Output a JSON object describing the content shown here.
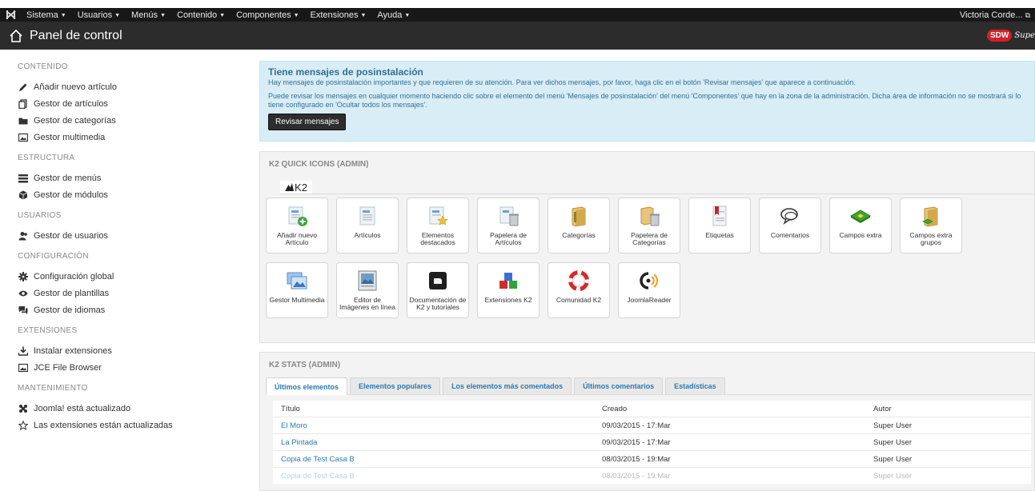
{
  "menubar": {
    "items": [
      "Sistema",
      "Usuarios",
      "Menús",
      "Contenido",
      "Componentes",
      "Extensiones",
      "Ayuda"
    ],
    "user": "Victoria Corde..."
  },
  "title": "Panel de control",
  "brand": {
    "badge": "SDW",
    "text": "Super Tise"
  },
  "sidebar": {
    "sections": [
      {
        "title": "CONTENIDO",
        "items": [
          "Añadir nuevo artículo",
          "Gestor de artículos",
          "Gestor de categorías",
          "Gestor multimedia"
        ]
      },
      {
        "title": "ESTRUCTURA",
        "items": [
          "Gestor de menús",
          "Gestor de módulos"
        ]
      },
      {
        "title": "USUARIOS",
        "items": [
          "Gestor de usuarios"
        ]
      },
      {
        "title": "CONFIGURACIÓN",
        "items": [
          "Configuración global",
          "Gestor de plantillas",
          "Gestor de idiomas"
        ]
      },
      {
        "title": "EXTENSIONES",
        "items": [
          "Instalar extensiones",
          "JCE File Browser"
        ]
      },
      {
        "title": "MANTENIMIENTO",
        "items": [
          "Joomla! está actualizado",
          "Las extensiones están actualizadas"
        ]
      }
    ]
  },
  "alert": {
    "heading": "Tiene mensajes de posinstalación",
    "p1": "Hay mensajes de posinstalación importantes y que requieren de su atención. Para ver dichos mensajes, por favor, haga clic en el botón 'Revisar mensajes' que aparece a continuación.",
    "p2": "Puede revisar los mensajes en cualquier momento haciendo clic sobre el elemento del menú 'Mensajes de posinstalación' del menú 'Componentes' que hay en la zona de la administración. Dicha área de información no se mostrará si lo tiene configurado en 'Ocultar todos los mensajes'.",
    "button": "Revisar mensajes"
  },
  "quickicons": {
    "title": "K2 QUICK ICONS (ADMIN)",
    "logo": "K2",
    "items": [
      {
        "label": "Añadir nuevo Artículo",
        "icon": "add-item-icon"
      },
      {
        "label": "Artículos",
        "icon": "items-icon"
      },
      {
        "label": "Elementos destacados",
        "icon": "featured-items-icon"
      },
      {
        "label": "Papelera de Artículos",
        "icon": "items-trash-icon"
      },
      {
        "label": "Categorías",
        "icon": "categories-icon"
      },
      {
        "label": "Papelera de Categorías",
        "icon": "categories-trash-icon"
      },
      {
        "label": "Etiquetas",
        "icon": "tags-icon"
      },
      {
        "label": "Comentarios",
        "icon": "comments-icon"
      },
      {
        "label": "Campos extra",
        "icon": "extra-fields-icon"
      },
      {
        "label": "Campos extra grupos",
        "icon": "extra-field-groups-icon"
      },
      {
        "label": "Gestor Multimedia",
        "icon": "media-manager-icon"
      },
      {
        "label": "Editor de Imágenes en línea",
        "icon": "image-editor-icon"
      },
      {
        "label": "Documentación de K2 y tutoriales",
        "icon": "documentation-icon"
      },
      {
        "label": "Extensiones K2",
        "icon": "extensions-icon"
      },
      {
        "label": "Comunidad K2",
        "icon": "community-icon"
      },
      {
        "label": "JoomlaReader",
        "icon": "joomlareader-icon"
      }
    ]
  },
  "stats": {
    "title": "K2 STATS (ADMIN)",
    "tabs": [
      "Últimos elementos",
      "Elementos populares",
      "Los elementos más comentados",
      "Últimos comentarios",
      "Estadísticas"
    ],
    "columns": [
      "Título",
      "Creado",
      "Autor"
    ],
    "rows": [
      [
        "El Moro",
        "09/03/2015 - 17:Mar",
        "Super User"
      ],
      [
        "La Pintada",
        "09/03/2015 - 17:Mar",
        "Super User"
      ],
      [
        "Copia de Test Casa B",
        "08/03/2015 - 19:Mar",
        "Super User"
      ],
      [
        "Copia de Test Casa B",
        "08/03/2015 - 19:Mar",
        "Super User"
      ]
    ]
  }
}
